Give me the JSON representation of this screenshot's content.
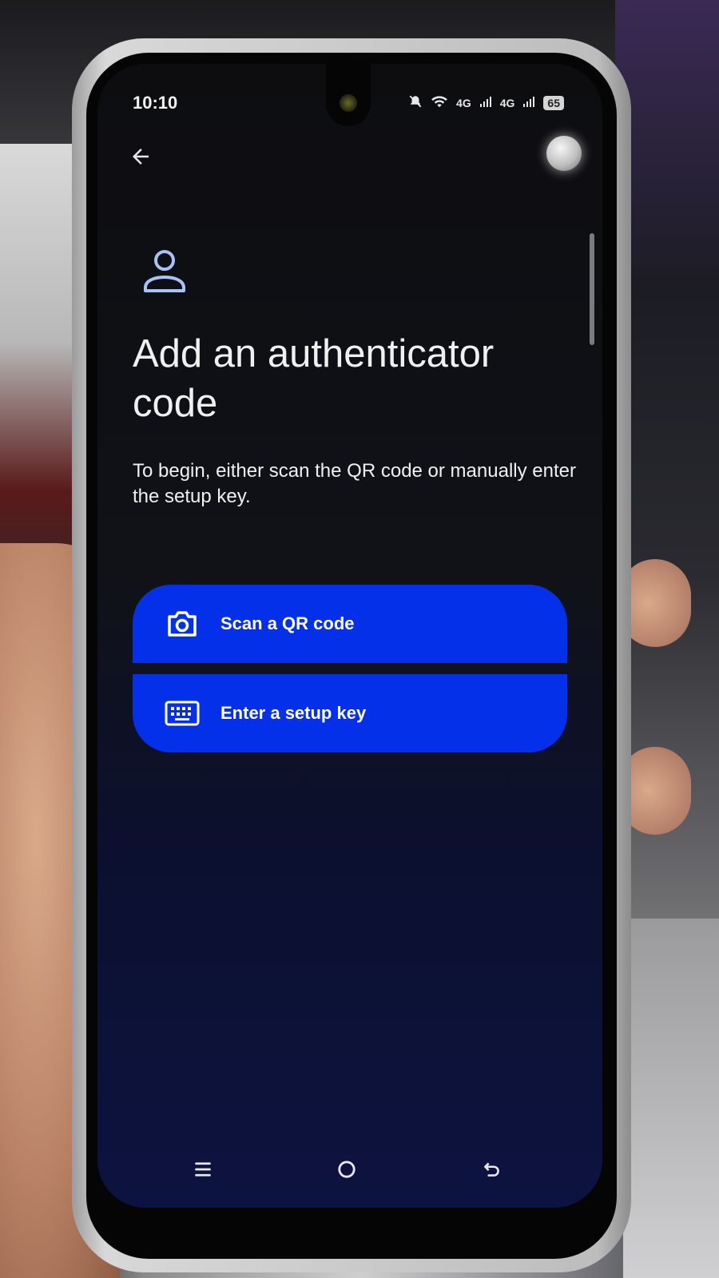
{
  "status_bar": {
    "time": "10:10",
    "network_1": "4G",
    "network_2": "4G",
    "battery": "65"
  },
  "header": {
    "back_icon": "arrow-back-icon"
  },
  "main": {
    "title": "Add an authenticator code",
    "description": "To begin, either scan the QR code or manually enter the setup key.",
    "accent_color": "#0530ea"
  },
  "actions": {
    "scan_label": "Scan a QR code",
    "scan_icon": "camera-icon",
    "key_label": "Enter a setup key",
    "key_icon": "keyboard-icon"
  },
  "nav_bar": {
    "icons": [
      "menu-icon",
      "home-icon",
      "back-icon"
    ]
  }
}
